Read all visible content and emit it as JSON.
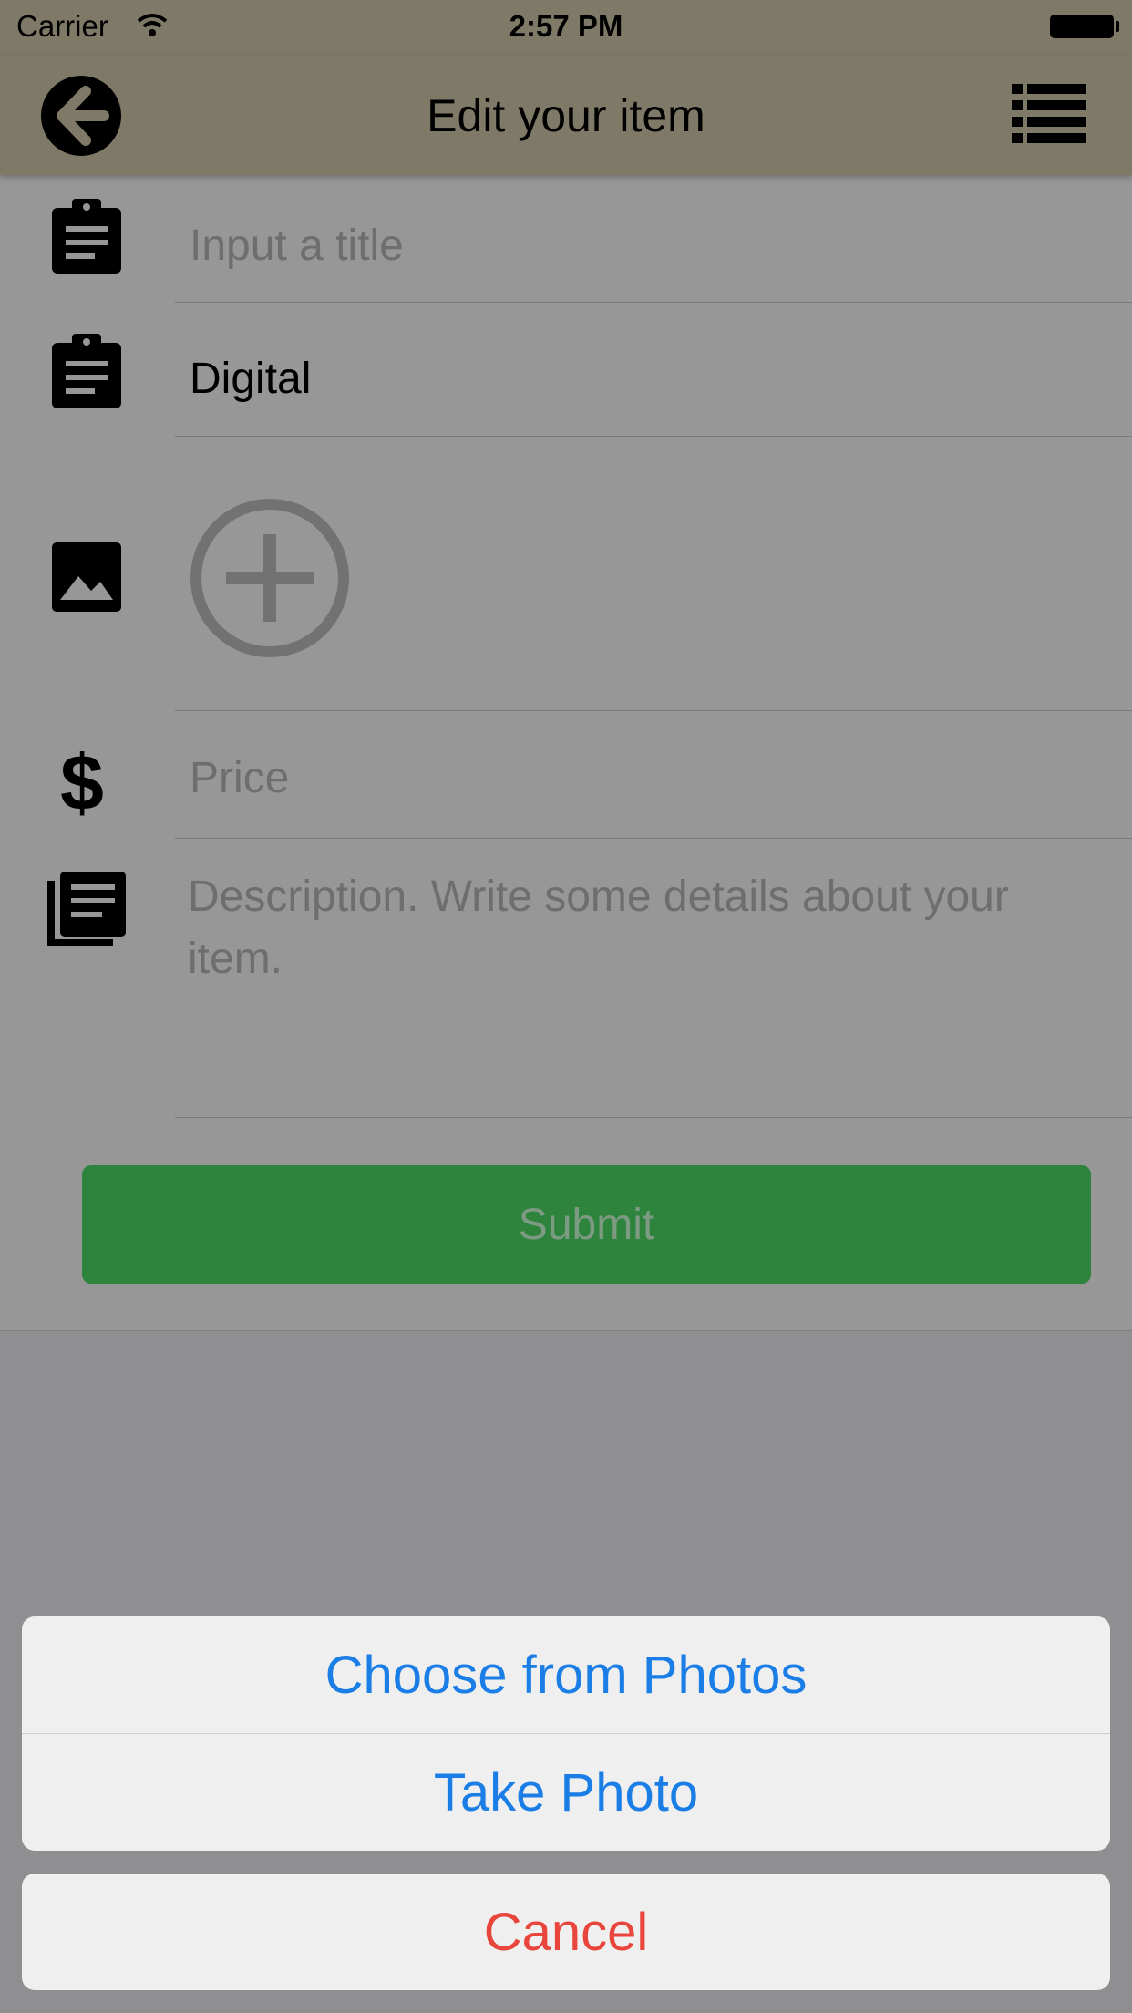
{
  "status_bar": {
    "carrier": "Carrier",
    "time": "2:57 PM"
  },
  "nav": {
    "title": "Edit your item",
    "back_icon": "arrow-left-circle-icon",
    "list_icon": "list-icon"
  },
  "form": {
    "title_placeholder": "Input a title",
    "category_value": "Digital",
    "price_placeholder": "Price",
    "description_placeholder": " Description. Write some details about your item.",
    "submit_label": "Submit"
  },
  "action_sheet": {
    "choose_label": "Choose from Photos",
    "take_label": "Take Photo",
    "cancel_label": "Cancel"
  },
  "colors": {
    "nav_bg": "#7f7967",
    "submit_bg": "#2e843d",
    "action_blue": "#1a7ee6",
    "cancel_red": "#e8453c"
  }
}
